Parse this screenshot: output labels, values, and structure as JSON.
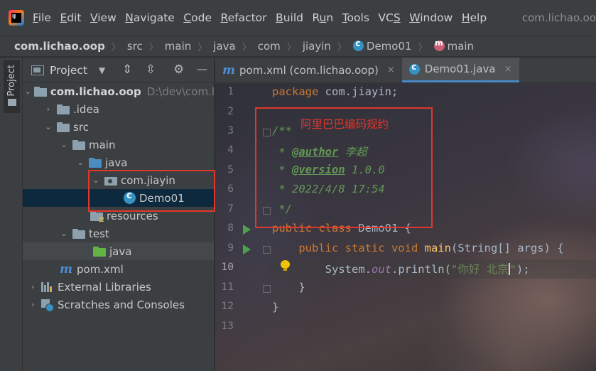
{
  "menubar": {
    "logo_text": "IJ",
    "items": [
      {
        "label": "File",
        "mnemonic": "F"
      },
      {
        "label": "Edit",
        "mnemonic": "E"
      },
      {
        "label": "View",
        "mnemonic": "V"
      },
      {
        "label": "Navigate",
        "mnemonic": "N"
      },
      {
        "label": "Code",
        "mnemonic": "C"
      },
      {
        "label": "Refactor",
        "mnemonic": "R"
      },
      {
        "label": "Build",
        "mnemonic": "B"
      },
      {
        "label": "Run",
        "mnemonic": "u"
      },
      {
        "label": "Tools",
        "mnemonic": "T"
      },
      {
        "label": "VCS",
        "mnemonic": "S"
      },
      {
        "label": "Window",
        "mnemonic": "W"
      },
      {
        "label": "Help",
        "mnemonic": "H"
      }
    ],
    "window_title": "com.lichao.oo"
  },
  "breadcrumb": {
    "items": [
      "com.lichao.oop",
      "src",
      "main",
      "java",
      "com",
      "jiayin",
      "Demo01",
      "main"
    ]
  },
  "tool_stripe": {
    "project_label": "Project"
  },
  "project_panel": {
    "title": "Project",
    "buttons": {
      "dropdown": "▼",
      "expand": "⇕",
      "collapse": "⇳",
      "settings": "⚙",
      "hide": "—"
    },
    "tree": [
      {
        "label": "com.lichao.oop",
        "hint": "D:\\dev\\com.l",
        "depth": 0,
        "arrow": "expanded",
        "icon": "module"
      },
      {
        "label": ".idea",
        "depth": 1,
        "arrow": "collapsed",
        "icon": "folder"
      },
      {
        "label": "src",
        "depth": 1,
        "arrow": "expanded",
        "icon": "folder"
      },
      {
        "label": "main",
        "depth": 2,
        "arrow": "expanded",
        "icon": "folder"
      },
      {
        "label": "java",
        "depth": 3,
        "arrow": "expanded",
        "icon": "folder-blue"
      },
      {
        "label": "com.jiayin",
        "depth": 4,
        "arrow": "expanded",
        "icon": "package"
      },
      {
        "label": "Demo01",
        "depth": 5,
        "arrow": "none",
        "icon": "class",
        "selected": true
      },
      {
        "label": "resources",
        "depth": 4,
        "arrow": "none",
        "icon": "folder-res"
      },
      {
        "label": "test",
        "depth": 2,
        "arrow": "expanded",
        "icon": "folder"
      },
      {
        "label": "java",
        "depth": 3,
        "arrow": "none",
        "icon": "folder-green",
        "hover": true
      },
      {
        "label": "pom.xml",
        "depth": 2,
        "arrow": "none",
        "icon": "maven"
      },
      {
        "label": "External Libraries",
        "depth": 0,
        "arrow": "collapsed",
        "icon": "library"
      },
      {
        "label": "Scratches and Consoles",
        "depth": 0,
        "arrow": "collapsed",
        "icon": "scratch"
      }
    ]
  },
  "editor": {
    "tabs": [
      {
        "label": "pom.xml (com.lichao.oop)",
        "icon": "maven",
        "close": "×",
        "active": false
      },
      {
        "label": "Demo01.java",
        "icon": "class",
        "close": "×",
        "active": true
      }
    ],
    "annotation": "阿里巴巴编码规约",
    "current_line": 10,
    "lines": [
      {
        "n": "1"
      },
      {
        "n": "2"
      },
      {
        "n": "3"
      },
      {
        "n": "4"
      },
      {
        "n": "5"
      },
      {
        "n": "6"
      },
      {
        "n": "7"
      },
      {
        "n": "8"
      },
      {
        "n": "9"
      },
      {
        "n": "10"
      },
      {
        "n": "11"
      },
      {
        "n": "12"
      },
      {
        "n": "13"
      }
    ],
    "code": {
      "l1_kw": "package",
      "l1_rest": " com.jiayin;",
      "l3": "/**",
      "l4_star": " * ",
      "l4_tag": "@author",
      "l4_val": " 李超",
      "l5_star": " * ",
      "l5_tag": "@version",
      "l5_val": " 1.0.0",
      "l6": " * 2022/4/8 17:54",
      "l7": " */",
      "l8_kw": "public class",
      "l8_rest": " Demo01 {",
      "l9_kw": "    public static void",
      "l9_fn": " main",
      "l9_rest": "(String[] args) {",
      "l10_a": "        System.",
      "l10_field": "out",
      "l10_b": ".println(",
      "l10_str_a": "\"你好 北京",
      "l10_str_b": "\"",
      "l10_c": ");",
      "l11": "    }",
      "l12": "}"
    }
  },
  "colors": {
    "accent": "#4a88c7",
    "highlight_box": "#e0372d",
    "selection": "#0d293e"
  }
}
